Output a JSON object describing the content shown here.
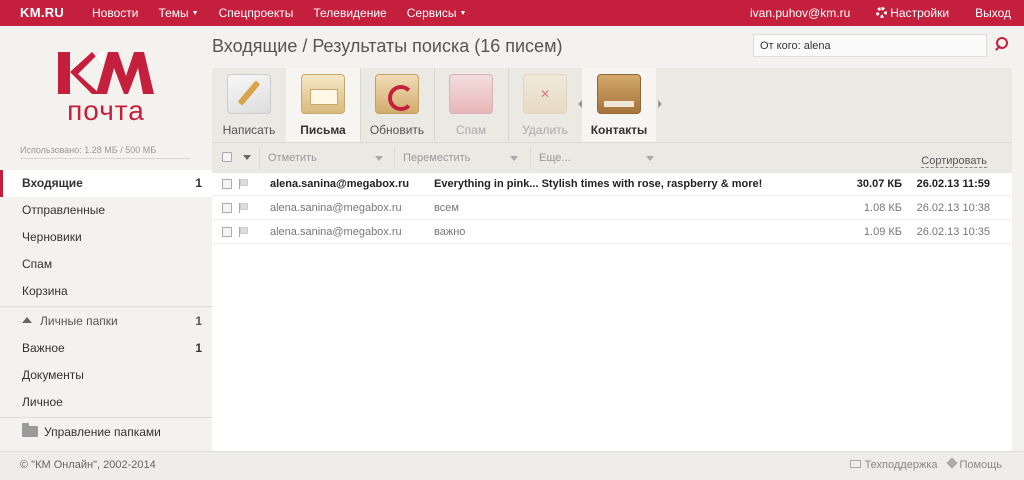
{
  "topbar": {
    "logo": "KM.RU",
    "nav": [
      {
        "label": "Новости",
        "dropdown": false
      },
      {
        "label": "Темы",
        "dropdown": true
      },
      {
        "label": "Спецпроекты",
        "dropdown": false
      },
      {
        "label": "Телевидение",
        "dropdown": false
      },
      {
        "label": "Сервисы",
        "dropdown": true
      }
    ],
    "user_email": "ivan.puhov@km.ru",
    "settings_label": "Настройки",
    "logout_label": "Выход"
  },
  "brand": {
    "km": "КМ",
    "sub": "почта"
  },
  "usage_text": "Использовано: 1.28 МБ / 500 МБ",
  "folders": {
    "inbox": {
      "label": "Входящие",
      "count": "1"
    },
    "sent": {
      "label": "Отправленные"
    },
    "drafts": {
      "label": "Черновики"
    },
    "spam": {
      "label": "Спам"
    },
    "trash": {
      "label": "Корзина"
    },
    "personal_section": {
      "label": "Личные папки",
      "count": "1"
    },
    "important": {
      "label": "Важное",
      "count": "1"
    },
    "documents": {
      "label": "Документы"
    },
    "personal": {
      "label": "Личное"
    },
    "manage": {
      "label": "Управление папками"
    }
  },
  "main": {
    "title": "Входящие / Результаты поиска (16 писем)",
    "search_value": "От кого: alena"
  },
  "toolbar": {
    "compose": "Написать",
    "letters": "Письма",
    "refresh": "Обновить",
    "spam": "Спам",
    "delete": "Удалить",
    "contacts": "Контакты"
  },
  "listhead": {
    "mark": "Отметить",
    "move": "Переместить",
    "more": "Еще...",
    "sort": "Сортировать"
  },
  "mails": [
    {
      "from": "alena.sanina@megabox.ru",
      "subject": "Everything in pink... Stylish times with rose, raspberry & more!",
      "size": "30.07 КБ",
      "date": "26.02.13 11:59",
      "unread": true
    },
    {
      "from": "alena.sanina@megabox.ru",
      "subject": "всем",
      "size": "1.08 КБ",
      "date": "26.02.13 10:38",
      "unread": false
    },
    {
      "from": "alena.sanina@megabox.ru",
      "subject": "важно",
      "size": "1.09 КБ",
      "date": "26.02.13 10:35",
      "unread": false
    }
  ],
  "footer": {
    "copyright": "© \"КМ Онлайн\", 2002-2014",
    "support": "Техподдержка",
    "help": "Помощь"
  },
  "colors": {
    "accent": "#c51f3e",
    "background": "#f3f2ee"
  },
  "icons": {
    "settings": "gear-icon",
    "search": "search-icon",
    "folder": "folder-icon",
    "flag": "flag-icon"
  }
}
